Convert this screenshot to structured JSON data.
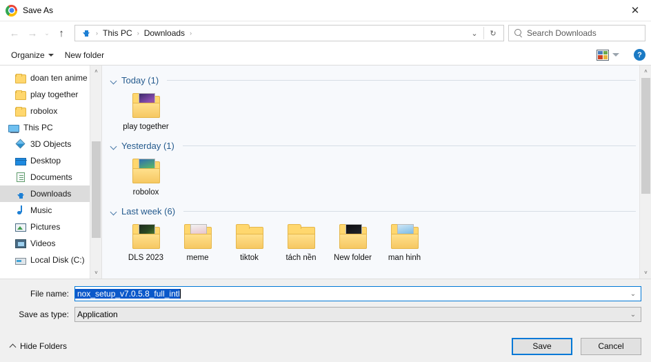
{
  "window": {
    "title": "Save As",
    "app_icon": "chrome-logo-icon",
    "close_label": "✕"
  },
  "nav": {
    "back_icon": "←",
    "forward_icon": "→",
    "history_icon": "⌄",
    "up_icon": "↑",
    "breadcrumb_icon": "downloads-arrow-icon",
    "crumbs": [
      "This PC",
      "Downloads"
    ],
    "separator": "›",
    "dropdown_icon": "⌄",
    "refresh_icon": "↻",
    "search_placeholder": "Search Downloads",
    "search_value": ""
  },
  "toolbar": {
    "organize_label": "Organize",
    "new_folder_label": "New folder",
    "view_icon": "view-layout-icon",
    "view_caret_icon": "chevron-down-icon",
    "help_label": "?"
  },
  "sidebar": {
    "items": [
      {
        "label": "doan ten anime",
        "icon": "folder-icon",
        "type": "folder",
        "selected": false
      },
      {
        "label": "play together",
        "icon": "folder-icon",
        "type": "folder",
        "selected": false
      },
      {
        "label": "robolox",
        "icon": "folder-icon",
        "type": "folder",
        "selected": false
      },
      {
        "label": "This PC",
        "icon": "this-pc-icon",
        "type": "root",
        "selected": false
      },
      {
        "label": "3D Objects",
        "icon": "3d-objects-icon",
        "type": "child",
        "selected": false
      },
      {
        "label": "Desktop",
        "icon": "desktop-icon",
        "type": "child",
        "selected": false
      },
      {
        "label": "Documents",
        "icon": "documents-icon",
        "type": "child",
        "selected": false
      },
      {
        "label": "Downloads",
        "icon": "downloads-icon",
        "type": "child",
        "selected": true
      },
      {
        "label": "Music",
        "icon": "music-icon",
        "type": "child",
        "selected": false
      },
      {
        "label": "Pictures",
        "icon": "pictures-icon",
        "type": "child",
        "selected": false
      },
      {
        "label": "Videos",
        "icon": "videos-icon",
        "type": "child",
        "selected": false
      },
      {
        "label": "Local Disk (C:)",
        "icon": "local-disk-icon",
        "type": "child",
        "selected": false
      }
    ],
    "scroll_up_icon": "˄",
    "scroll_down_icon": "˅"
  },
  "files": {
    "groups": [
      {
        "title": "Today (1)",
        "collapse_icon": "chevron-down-icon",
        "items": [
          {
            "name": "play together",
            "icon": "folder-preview-icon",
            "has_preview": true
          }
        ]
      },
      {
        "title": "Yesterday (1)",
        "collapse_icon": "chevron-down-icon",
        "items": [
          {
            "name": "robolox",
            "icon": "folder-preview-icon",
            "has_preview": true
          }
        ]
      },
      {
        "title": "Last week (6)",
        "collapse_icon": "chevron-down-icon",
        "items": [
          {
            "name": "DLS 2023",
            "icon": "folder-preview-icon",
            "has_preview": true
          },
          {
            "name": "meme",
            "icon": "folder-preview-icon",
            "has_preview": true
          },
          {
            "name": "tiktok",
            "icon": "folder-icon",
            "has_preview": false
          },
          {
            "name": "tách nền",
            "icon": "folder-icon",
            "has_preview": false
          },
          {
            "name": "New folder",
            "icon": "folder-preview-icon",
            "has_preview": true
          },
          {
            "name": "man hinh",
            "icon": "folder-preview-icon",
            "has_preview": true
          }
        ]
      }
    ],
    "scroll_up_icon": "˄",
    "scroll_down_icon": "˅"
  },
  "form": {
    "file_name_label": "File name:",
    "file_name_value": "nox_setup_v7.0.5.8_full_intl",
    "file_name_selected": true,
    "save_type_label": "Save as type:",
    "save_type_value": "Application",
    "dropdown_icon": "⌄"
  },
  "footer": {
    "hide_folders_label": "Hide Folders",
    "hide_folders_icon": "chevron-up-icon",
    "save_label": "Save",
    "cancel_label": "Cancel"
  },
  "colors": {
    "accent": "#0078d7",
    "selection": "#0a58ca",
    "group_header": "#245a8d",
    "folder": "#ffd76e",
    "dialog_bg": "#f0f0f0",
    "pane_bg": "#f7f9fc"
  }
}
